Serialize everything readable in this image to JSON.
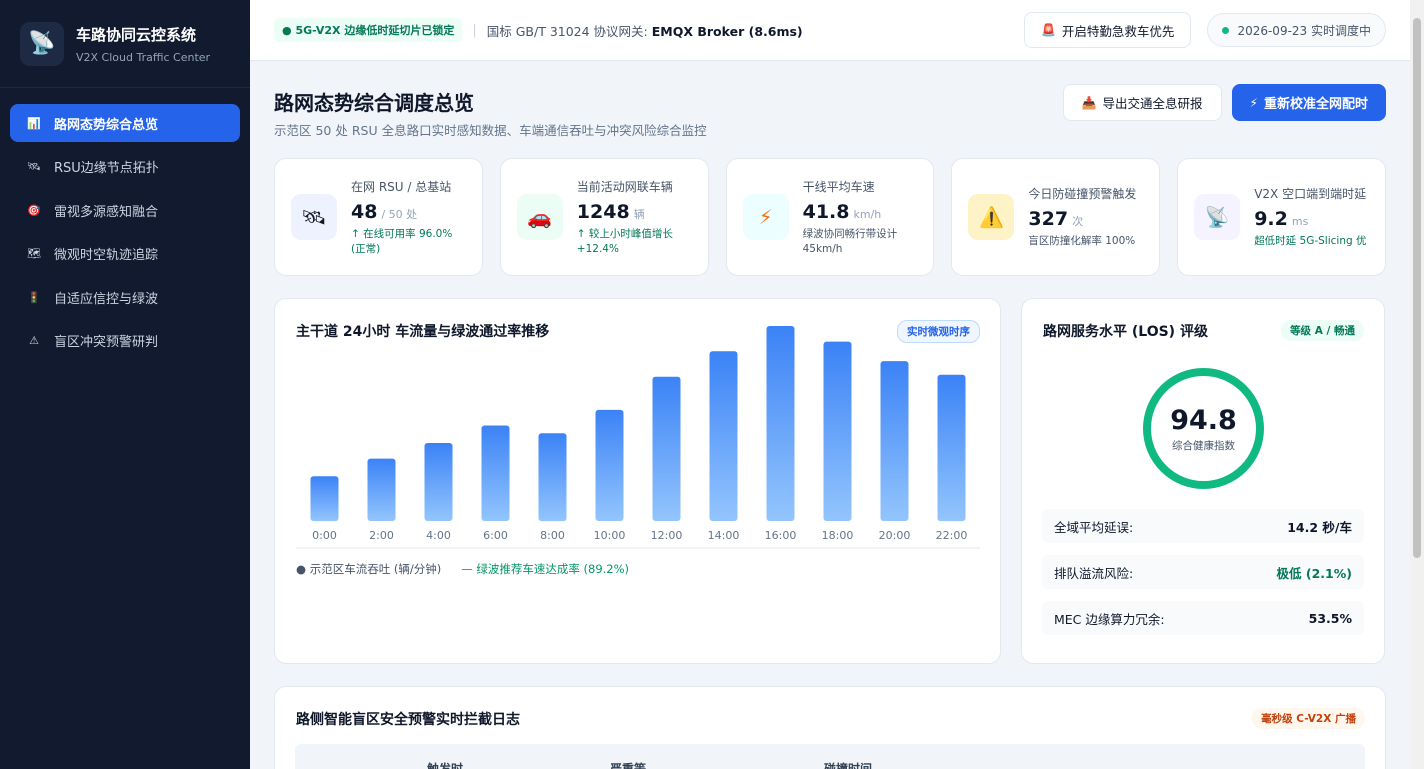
{
  "sidebar": {
    "title": "车路协同云控系统",
    "subtitle": "V2X Cloud Traffic Center",
    "logo_icon": "satellite-dish-icon",
    "items": [
      {
        "label": "路网态势综合总览",
        "icon": "bar-chart-icon",
        "active": true
      },
      {
        "label": "RSU边缘节点拓扑",
        "icon": "satellite-icon",
        "active": false
      },
      {
        "label": "雷视多源感知融合",
        "icon": "target-icon",
        "active": false
      },
      {
        "label": "微观时空轨迹追踪",
        "icon": "map-icon",
        "active": false
      },
      {
        "label": "自适应信控与绿波",
        "icon": "traffic-light-icon",
        "active": false
      },
      {
        "label": "盲区冲突预警研判",
        "icon": "warning-icon",
        "active": false
      }
    ]
  },
  "topbar": {
    "slice_badge": "5G-V2X 边缘低时延切片已锁定",
    "separator": "|",
    "gateway_prefix": "国标 GB/T 31024 协议网关:",
    "gateway_value": "EMQX Broker (8.6ms)",
    "emergency_button": "开启特勤急救车优先",
    "date_status": "2026-09-23 实时调度中"
  },
  "page": {
    "title": "路网态势综合调度总览",
    "subtitle": "示范区 50 处 RSU 全息路口实时感知数据、车端通信吞吐与冲突风险综合监控",
    "export_button": "导出交通全息研报",
    "recalibrate_button": "重新校准全网配时"
  },
  "stats": [
    {
      "label": "在网 RSU / 总基站",
      "value": "48",
      "unit": "/ 50 处",
      "note": "↑ 在线可用率 96.0% (正常)",
      "icon": "satellite-icon",
      "icon_bg": "#eef2ff",
      "note_color": "#047857"
    },
    {
      "label": "当前活动网联车辆",
      "value": "1248",
      "unit": "辆",
      "note": "↑ 较上小时峰值增长 +12.4%",
      "icon": "car-icon",
      "icon_bg": "#ecfdf5",
      "note_color": "#047857"
    },
    {
      "label": "干线平均车速",
      "value": "41.8",
      "unit": "km/h",
      "note": "绿波协同畅行带设计 45km/h",
      "icon": "lightning-icon",
      "icon_bg": "#ecfeff",
      "note_color": "#475569"
    },
    {
      "label": "今日防碰撞预警触发",
      "value": "327",
      "unit": "次",
      "note": "盲区防撞化解率 100%",
      "icon": "warning-icon",
      "icon_bg": "#fef3c7",
      "note_color": "#475569"
    },
    {
      "label": "V2X 空口端到端时延",
      "value": "9.2",
      "unit": "ms",
      "note": "超低时延 5G-Slicing 优",
      "icon": "antenna-icon",
      "icon_bg": "#f5f3ff",
      "note_color": "#047857"
    }
  ],
  "chart_card": {
    "title": "主干道 24小时 车流量与绿波通过率推移",
    "badge": "实时微观时序",
    "legend_flow": "● 示范区车流吞吐 (辆/分钟)",
    "legend_rate": "— 绿波推荐车速达成率 (89.2%)"
  },
  "chart_data": {
    "type": "bar",
    "categories": [
      "0:00",
      "2:00",
      "4:00",
      "6:00",
      "8:00",
      "10:00",
      "12:00",
      "14:00",
      "16:00",
      "18:00",
      "20:00",
      "22:00"
    ],
    "values": [
      23,
      32,
      40,
      49,
      45,
      57,
      74,
      87,
      100,
      92,
      82,
      75
    ],
    "ylim": [
      0,
      100
    ],
    "bar_color_top": "#3b82f6",
    "bar_color_bottom": "#93c5fd"
  },
  "los_card": {
    "title": "路网服务水平 (LOS) 评级",
    "badge": "等级 A / 畅通",
    "score": "94.8",
    "score_label": "综合健康指数",
    "rows": [
      {
        "label": "全域平均延误:",
        "value": "14.2 秒/车",
        "color": "#0f172a"
      },
      {
        "label": "排队溢流风险:",
        "value": "极低 (2.1%)",
        "color": "#047857"
      },
      {
        "label": "MEC 边缘算力冗余:",
        "value": "53.5%",
        "color": "#0f172a"
      }
    ]
  },
  "log_card": {
    "title": "路侧智能盲区安全预警实时拦截日志",
    "badge": "毫秒级 C-V2X 广播",
    "columns": [
      "触发时",
      "严重等",
      "碰撞时间"
    ]
  },
  "colors": {
    "accent": "#2563eb",
    "success": "#10b981",
    "sidebar_bg": "#111a2e"
  }
}
